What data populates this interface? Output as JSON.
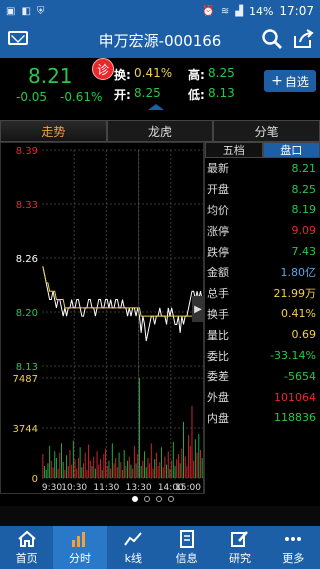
{
  "status": {
    "battery": "14%",
    "time": "17:07"
  },
  "header": {
    "title": "申万宏源-000166"
  },
  "quote": {
    "price": "8.21",
    "change": "-0.05",
    "change_pct": "-0.61%",
    "diag_label": "诊",
    "turnover_label": "换:",
    "turnover": "0.41%",
    "open_label": "开:",
    "open": "8.25",
    "high_label": "高:",
    "high": "8.25",
    "low_label": "低:",
    "low": "8.13",
    "add_label": "自选"
  },
  "tabs": [
    "走势",
    "龙虎",
    "分笔"
  ],
  "side_tabs": [
    "五档",
    "盘口"
  ],
  "panel": [
    {
      "label": "最新",
      "value": "8.21",
      "color": "#28c74a"
    },
    {
      "label": "开盘",
      "value": "8.25",
      "color": "#28c74a"
    },
    {
      "label": "均价",
      "value": "8.19",
      "color": "#28c74a"
    },
    {
      "label": "涨停",
      "value": "9.09",
      "color": "#e8282b"
    },
    {
      "label": "跌停",
      "value": "7.43",
      "color": "#28c74a"
    },
    {
      "label": "金额",
      "value": "1.80亿",
      "color": "#5aa6e8"
    },
    {
      "label": "总手",
      "value": "21.99万",
      "color": "#f0d050"
    },
    {
      "label": "换手",
      "value": "0.41%",
      "color": "#f0d050"
    },
    {
      "label": "量比",
      "value": "0.69",
      "color": "#f0d050"
    },
    {
      "label": "委比",
      "value": "-33.14%",
      "color": "#28c74a"
    },
    {
      "label": "委差",
      "value": "-5654",
      "color": "#28c74a"
    },
    {
      "label": "外盘",
      "value": "101064",
      "color": "#e8282b"
    },
    {
      "label": "内盘",
      "value": "118836",
      "color": "#28c74a"
    }
  ],
  "chart_data": {
    "type": "line",
    "price_ticks": [
      {
        "label": "8.39",
        "color": "#e8282b"
      },
      {
        "label": "8.33",
        "color": "#e8282b"
      },
      {
        "label": "8.26",
        "color": "#ffffff"
      },
      {
        "label": "8.20",
        "color": "#28c74a"
      },
      {
        "label": "8.13",
        "color": "#28c74a"
      }
    ],
    "volume_ticks": [
      {
        "label": "7487",
        "color": "#f0d050"
      },
      {
        "label": "3744",
        "color": "#f0d050"
      },
      {
        "label": "0",
        "color": "#f0d050"
      }
    ],
    "time_ticks": [
      "9:30",
      "10:30",
      "11:30",
      "13:30",
      "14:00",
      "15:00"
    ],
    "ylim": [
      8.13,
      8.39
    ],
    "volume_max": 7487,
    "price": [
      8.25,
      8.24,
      8.23,
      8.22,
      8.21,
      8.21,
      8.22,
      8.21,
      8.2,
      8.21,
      8.21,
      8.2,
      8.19,
      8.2,
      8.19,
      8.2,
      8.2,
      8.21,
      8.2,
      8.2,
      8.21,
      8.21,
      8.2,
      8.19,
      8.19,
      8.2,
      8.2,
      8.21,
      8.21,
      8.2,
      8.2,
      8.19,
      8.2,
      8.21,
      8.21,
      8.2,
      8.2,
      8.21,
      8.21,
      8.2,
      8.21,
      8.2,
      8.2,
      8.21,
      8.21,
      8.2,
      8.2,
      8.21,
      8.2,
      8.2,
      8.19,
      8.2,
      8.19,
      8.2,
      8.2,
      8.19,
      8.2,
      8.19,
      8.17,
      8.19,
      8.18,
      8.16,
      8.17,
      8.18,
      8.19,
      8.19,
      8.18,
      8.19,
      8.19,
      8.2,
      8.19,
      8.19,
      8.19,
      8.18,
      8.2,
      8.19,
      8.2,
      8.19,
      8.18,
      8.18,
      8.19,
      8.17,
      8.19,
      8.18,
      8.19,
      8.19,
      8.2,
      8.21,
      8.22,
      8.22,
      8.21,
      8.22,
      8.21,
      8.22,
      8.21
    ],
    "avg": [
      8.25,
      8.24,
      8.23,
      8.23,
      8.22,
      8.22,
      8.22,
      8.22,
      8.21,
      8.21,
      8.21,
      8.21,
      8.21,
      8.2,
      8.2,
      8.2,
      8.2,
      8.2,
      8.2,
      8.2,
      8.2,
      8.2,
      8.2,
      8.2,
      8.2,
      8.2,
      8.2,
      8.2,
      8.2,
      8.2,
      8.2,
      8.2,
      8.2,
      8.2,
      8.2,
      8.2,
      8.2,
      8.2,
      8.2,
      8.2,
      8.2,
      8.2,
      8.2,
      8.2,
      8.2,
      8.2,
      8.2,
      8.2,
      8.2,
      8.2,
      8.2,
      8.2,
      8.2,
      8.2,
      8.2,
      8.2,
      8.2,
      8.2,
      8.19,
      8.19,
      8.19,
      8.19,
      8.19,
      8.19,
      8.19,
      8.19,
      8.19,
      8.19,
      8.19,
      8.19,
      8.19,
      8.19,
      8.19,
      8.19,
      8.19,
      8.19,
      8.19,
      8.19,
      8.19,
      8.19,
      8.19,
      8.19,
      8.19,
      8.19,
      8.19,
      8.19,
      8.19,
      8.19,
      8.19,
      8.19,
      8.19,
      8.19,
      8.19,
      8.19,
      8.19
    ],
    "volume": [
      1800,
      900,
      600,
      1100,
      2400,
      1300,
      800,
      2000,
      1500,
      700,
      1900,
      2600,
      1200,
      600,
      1700,
      900,
      2100,
      1000,
      2800,
      1400,
      700,
      1500,
      2300,
      800,
      1100,
      1900,
      600,
      2500,
      1300,
      900,
      1600,
      700,
      2000,
      1000,
      1400,
      600,
      1800,
      2200,
      900,
      1300,
      700,
      2600,
      1100,
      1500,
      800,
      1900,
      1200,
      600,
      2100,
      900,
      1300,
      1600,
      1000,
      700,
      2400,
      1100,
      1800,
      7487,
      900,
      1300,
      2000,
      800,
      1500,
      1100,
      2600,
      700,
      1400,
      1900,
      900,
      1200,
      2300,
      800,
      1600,
      1000,
      2000,
      700,
      1300,
      2700,
      900,
      1400,
      1800,
      1100,
      2200,
      4200,
      1600,
      900,
      3200,
      2400,
      5400,
      1300,
      2900,
      1900,
      3300,
      2100,
      1500
    ]
  },
  "nav": [
    "首页",
    "分时",
    "k线",
    "信息",
    "研究",
    "更多"
  ]
}
